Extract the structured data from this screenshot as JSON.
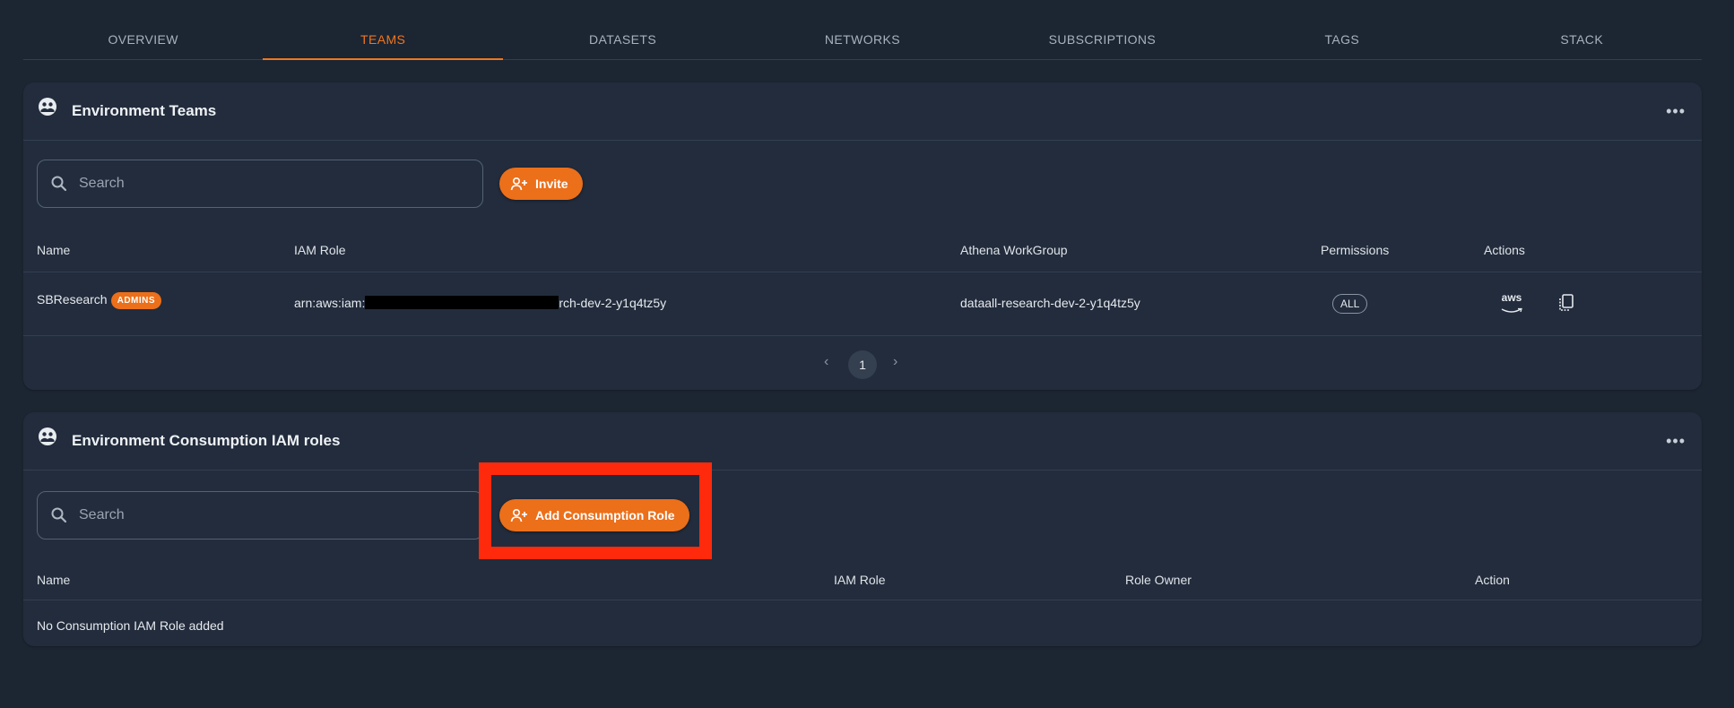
{
  "tabs": [
    "OVERVIEW",
    "TEAMS",
    "DATASETS",
    "NETWORKS",
    "SUBSCRIPTIONS",
    "TAGS",
    "STACK"
  ],
  "active_tab": "TEAMS",
  "teams_card": {
    "title": "Environment Teams",
    "search_placeholder": "Search",
    "invite_label": "Invite",
    "columns": {
      "name": "Name",
      "iam_role": "IAM Role",
      "athena": "Athena WorkGroup",
      "permissions": "Permissions",
      "actions": "Actions"
    },
    "rows": [
      {
        "name": "SBResearch",
        "badge": "ADMINS",
        "iam_role_prefix": "arn:aws:iam:",
        "iam_role_suffix": "rch-dev-2-y1q4tz5y",
        "athena_workgroup": "dataall-research-dev-2-y1q4tz5y",
        "permissions": "ALL",
        "aws_label": "aws"
      }
    ],
    "pagination": {
      "current_page": "1"
    }
  },
  "consumption_card": {
    "title": "Environment Consumption IAM roles",
    "search_placeholder": "Search",
    "add_label": "Add Consumption Role",
    "columns": {
      "name": "Name",
      "iam_role": "IAM Role",
      "role_owner": "Role Owner",
      "action": "Action"
    },
    "empty_text": "No Consumption IAM Role added"
  },
  "colors": {
    "accent": "#ec6f1a",
    "background": "#1c2532",
    "card": "#222c3c",
    "highlight": "#ff2a0c"
  },
  "icons": {
    "header": "team-icon",
    "search": "search-icon",
    "invite": "person-add-icon",
    "aws": "aws-console-icon",
    "copy": "copy-icon",
    "more": "more-horizontal-icon"
  }
}
